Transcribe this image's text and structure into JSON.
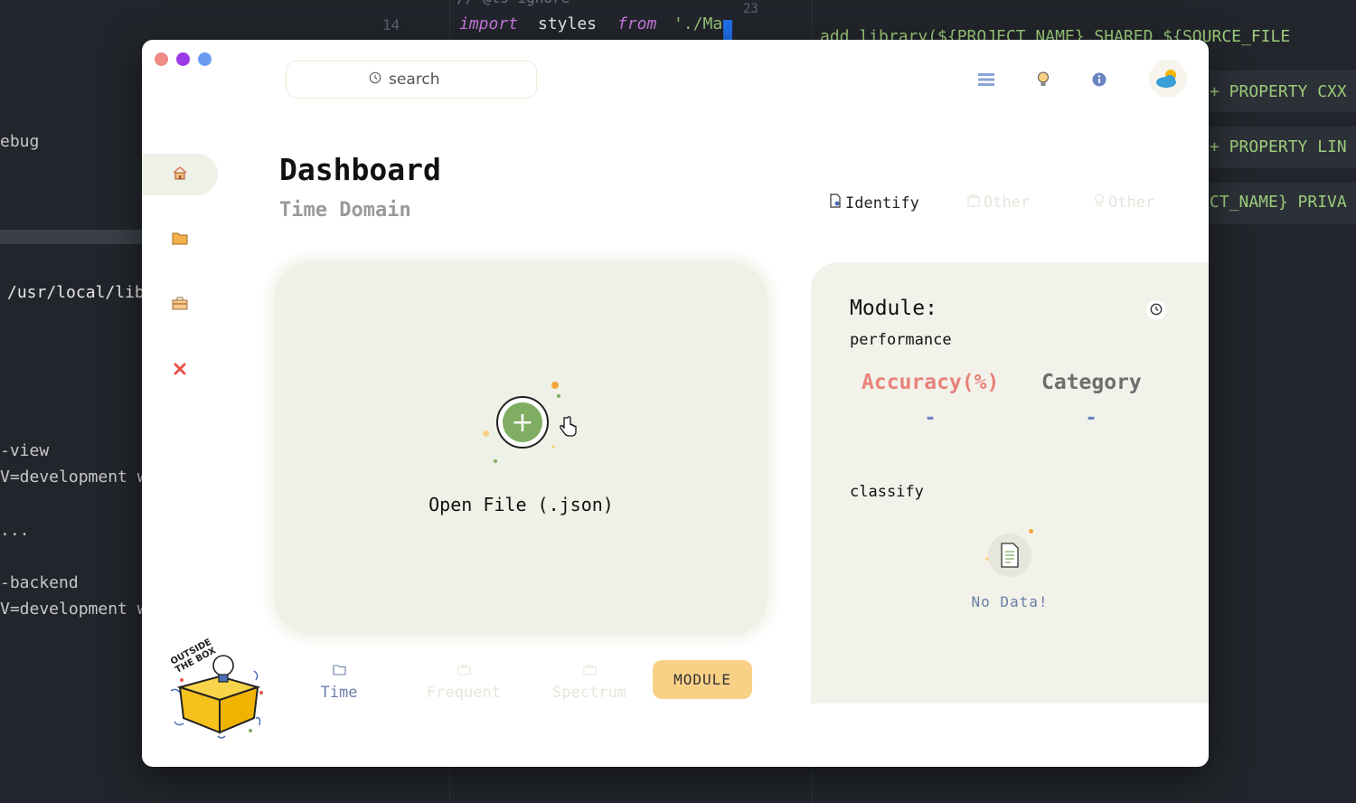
{
  "background_editor": {
    "lines": [
      {
        "text": "14",
        "kind": "num"
      },
      {
        "text": "import",
        "kind": "kw"
      },
      {
        "text": "styles",
        "kind": "plain"
      },
      {
        "text": "from",
        "kind": "kw"
      },
      {
        "text": "'./Ma",
        "kind": "str"
      },
      {
        "text": "23",
        "kind": "num"
      },
      {
        "text": "add_library(${PROJECT_NAME} SHARED ${SOURCE_FILE",
        "kind": "green"
      },
      {
        "text": "+ PROPERTY CXX",
        "kind": "green"
      },
      {
        "text": "+ PROPERTY LIN",
        "kind": "green"
      },
      {
        "text": "CT_NAME} PRIVA",
        "kind": "green"
      },
      {
        "text": "ebug",
        "kind": "dim"
      },
      {
        "text": "/usr/local/lib/",
        "kind": "plain"
      },
      {
        "text": "-view",
        "kind": "dim"
      },
      {
        "text": "V=development we",
        "kind": "dim"
      },
      {
        "text": "...",
        "kind": "dim"
      },
      {
        "text": "-backend",
        "kind": "dim"
      },
      {
        "text": "V=development we",
        "kind": "dim"
      }
    ]
  },
  "window": {
    "search": {
      "placeholder": "search",
      "icon": "clock-icon"
    },
    "top_icons": [
      "list-icon",
      "lightbulb-icon",
      "info-icon"
    ],
    "avatar": "weather-avatar",
    "sidebar": [
      {
        "icon": "home-icon",
        "active": true
      },
      {
        "icon": "folder-icon",
        "active": false
      },
      {
        "icon": "toolbox-icon",
        "active": false
      },
      {
        "icon": "close-icon",
        "active": false
      }
    ],
    "title": "Dashboard",
    "subtitle": "Time Domain",
    "mode_tabs": [
      {
        "label": "Identify",
        "active": true
      },
      {
        "label": "Other",
        "active": false
      },
      {
        "label": "Other",
        "active": false
      }
    ],
    "open_file": {
      "label": "Open File (.json)"
    },
    "bottom_tabs": [
      {
        "label": "Time",
        "active": true
      },
      {
        "label": "Frequent",
        "active": false
      },
      {
        "label": "Spectrum",
        "active": false
      }
    ],
    "module_button": "MODULE",
    "module_panel": {
      "title": "Module:",
      "section_performance": "performance",
      "metrics": [
        {
          "label": "Accuracy(%)",
          "value": "-",
          "color": "#e8837a"
        },
        {
          "label": "Category",
          "value": "-",
          "color": "#6e6e6e"
        }
      ],
      "section_classify": "classify",
      "empty_text": "No Data!"
    },
    "logo_text": "OUTSIDE THE BOX",
    "colors": {
      "traffic_red": "#f08b86",
      "traffic_purple": "#9b3be8",
      "traffic_blue": "#6b9bf0",
      "card_bg": "#eef1e6",
      "accent_green": "#7fae62",
      "module_button": "#f9d186",
      "inactive_text": "#e6e6dc"
    }
  }
}
